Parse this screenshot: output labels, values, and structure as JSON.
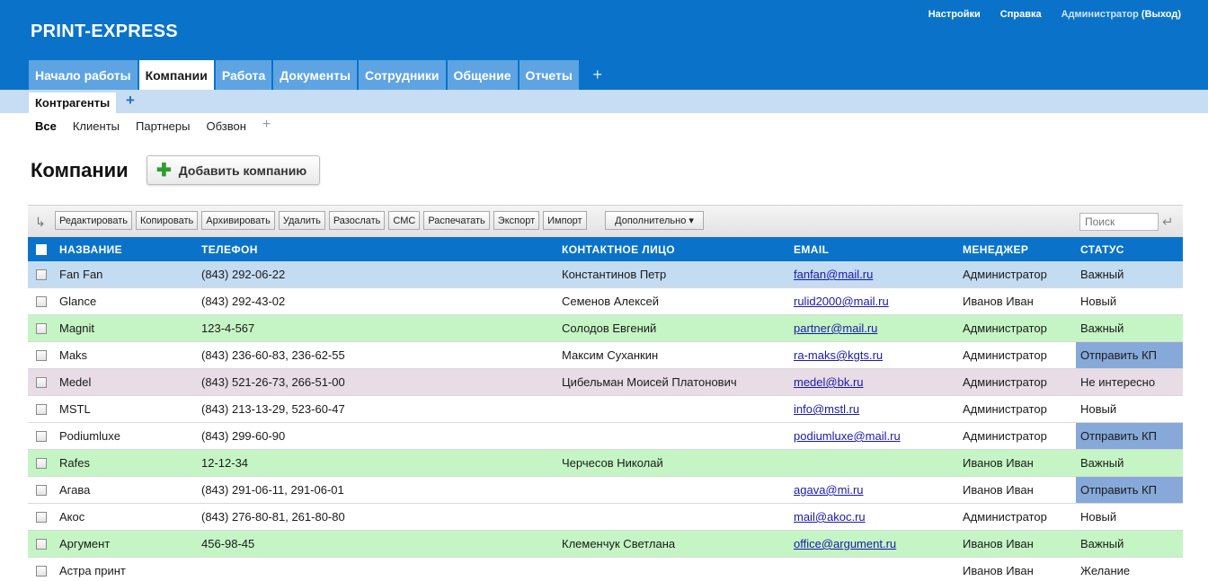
{
  "app": {
    "brand": "PRINT-EXPRESS",
    "top_links": {
      "settings": "Настройки",
      "help": "Справка",
      "user": "Администратор",
      "logout": "(Выход)"
    }
  },
  "main_tabs": [
    {
      "label": "Начало работы",
      "active": false
    },
    {
      "label": "Компании",
      "active": true
    },
    {
      "label": "Работа",
      "active": false
    },
    {
      "label": "Документы",
      "active": false
    },
    {
      "label": "Сотрудники",
      "active": false
    },
    {
      "label": "Общение",
      "active": false
    },
    {
      "label": "Отчеты",
      "active": false
    }
  ],
  "main_tab_add": "+",
  "sub_tab": {
    "label": "Контрагенты",
    "add": "+"
  },
  "filters": {
    "items": [
      "Все",
      "Клиенты",
      "Партнеры",
      "Обзвон"
    ],
    "active": "Все",
    "add": "+"
  },
  "page": {
    "title": "Компании",
    "add_button": "Добавить компанию"
  },
  "toolbar": {
    "buttons": [
      "Редактировать",
      "Копировать",
      "Архивировать",
      "Удалить",
      "Разослать",
      "СМС",
      "Распечатать",
      "Экспорт",
      "Импорт"
    ],
    "more": "Дополнительно",
    "search_placeholder": "Поиск"
  },
  "table": {
    "columns": [
      "НАЗВАНИЕ",
      "ТЕЛЕФОН",
      "КОНТАКТНОЕ ЛИЦО",
      "EMAIL",
      "МЕНЕДЖЕР",
      "СТАТУС"
    ],
    "rows": [
      {
        "name": "Fan Fan",
        "phone": "(843) 292-06-22",
        "contact": "Константинов Петр",
        "email": "fanfan@mail.ru",
        "manager": "Администратор",
        "status": "Важный",
        "bg": "selected",
        "status_bg": ""
      },
      {
        "name": "Glance",
        "phone": "(843) 292-43-02",
        "contact": "Семенов Алексей",
        "email": "rulid2000@mail.ru",
        "manager": "Иванов Иван",
        "status": "Новый",
        "bg": "white",
        "status_bg": ""
      },
      {
        "name": "Magnit",
        "phone": "123-4-567",
        "contact": "Солодов Евгений",
        "email": "partner@mail.ru",
        "manager": "Администратор",
        "status": "Важный",
        "bg": "green",
        "status_bg": ""
      },
      {
        "name": "Maks",
        "phone": "(843) 236-60-83, 236-62-55",
        "contact": "Максим Суханкин",
        "email": "ra-maks@kgts.ru",
        "manager": "Администратор",
        "status": "Отправить КП",
        "bg": "white",
        "status_bg": "blue"
      },
      {
        "name": "Medel",
        "phone": "(843) 521-26-73, 266-51-00",
        "contact": "Цибельман Моисей Платонович",
        "email": "medel@bk.ru",
        "manager": "Администратор",
        "status": "Не интересно",
        "bg": "purple",
        "status_bg": ""
      },
      {
        "name": "MSTL",
        "phone": "(843) 213-13-29, 523-60-47",
        "contact": "",
        "email": "info@mstl.ru",
        "manager": "Администратор",
        "status": "Новый",
        "bg": "white",
        "status_bg": ""
      },
      {
        "name": "Podiumluxe",
        "phone": "(843) 299-60-90",
        "contact": "",
        "email": "podiumluxe@mail.ru",
        "manager": "Администратор",
        "status": "Отправить КП",
        "bg": "white",
        "status_bg": "blue"
      },
      {
        "name": "Rafes",
        "phone": "12-12-34",
        "contact": "Черчесов Николай",
        "email": "",
        "manager": "Иванов Иван",
        "status": "Важный",
        "bg": "green",
        "status_bg": ""
      },
      {
        "name": "Агава",
        "phone": "(843) 291-06-11, 291-06-01",
        "contact": "",
        "email": "agava@mi.ru",
        "manager": "Иванов Иван",
        "status": "Отправить КП",
        "bg": "white",
        "status_bg": "blue"
      },
      {
        "name": "Акос",
        "phone": "(843) 276-80-81, 261-80-80",
        "contact": "",
        "email": "mail@akoc.ru",
        "manager": "Администратор",
        "status": "Новый",
        "bg": "white",
        "status_bg": ""
      },
      {
        "name": "Аргумент",
        "phone": "456-98-45",
        "contact": "Клеменчук Светлана",
        "email": "office@argument.ru",
        "manager": "Иванов Иван",
        "status": "Важный",
        "bg": "green",
        "status_bg": ""
      },
      {
        "name": "Астра принт",
        "phone": "",
        "contact": "",
        "email": "",
        "manager": "Иванов Иван",
        "status": "Желание",
        "bg": "white",
        "status_bg": ""
      }
    ]
  },
  "colors": {
    "header": "#0a73c9",
    "row_selected": "#c3dcf2",
    "row_green": "#c5f5c5",
    "row_purple": "#e8dce6",
    "status_blue": "#86a9d9"
  }
}
